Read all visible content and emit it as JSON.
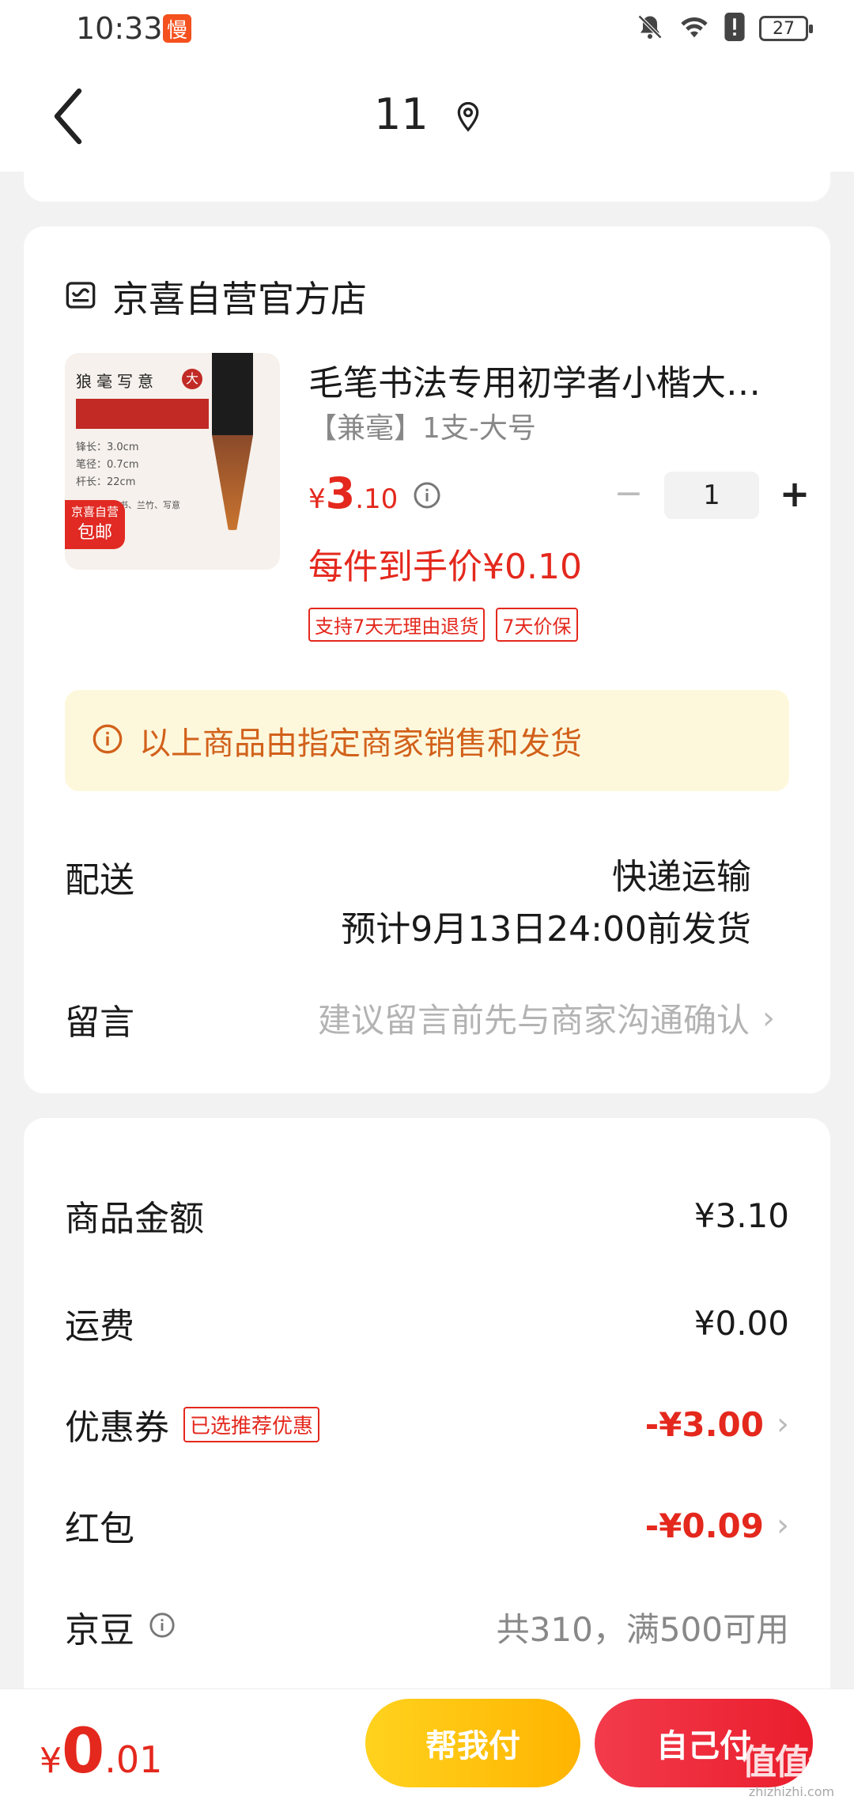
{
  "status_bar": {
    "time": "10:33",
    "slow_badge": "慢",
    "battery": "27"
  },
  "nav": {
    "title": "11"
  },
  "shop": {
    "name": "京喜自营官方店"
  },
  "thumbnail": {
    "title": "狼毫写意",
    "size_badge": "大",
    "spec_lines": [
      "锋长：3.0cm",
      "笔径：0.7cm",
      "杆长：22cm"
    ],
    "usage": "宜行楷、行书、兰竹、写意",
    "badge_line1": "京喜自营",
    "badge_line2": "包邮"
  },
  "product": {
    "title": "毛笔书法专用初学者小楷大楷狼毫写意",
    "spec": "【兼毫】1支-大号",
    "price_symbol": "¥",
    "price_int": "3",
    "price_dec": ".10",
    "quantity": "1",
    "minus": "−",
    "plus": "+",
    "unit_price": "每件到手价¥0.10",
    "tags": [
      "支持7天无理由退货",
      "7天价保"
    ]
  },
  "notice": {
    "text": "以上商品由指定商家销售和发货"
  },
  "delivery": {
    "label": "配送",
    "method": "快递运输",
    "eta": "预计9月13日24:00前发货"
  },
  "message": {
    "label": "留言",
    "placeholder": "建议留言前先与商家沟通确认"
  },
  "fees": {
    "goods": {
      "label": "商品金额",
      "value": "¥3.10"
    },
    "shipping": {
      "label": "运费",
      "value": "¥0.00"
    },
    "coupon": {
      "label": "优惠券",
      "tag": "已选推荐优惠",
      "value": "-¥3.00"
    },
    "redpacket": {
      "label": "红包",
      "value": "-¥0.09"
    },
    "jingdou": {
      "label": "京豆",
      "value": "共310，满500可用"
    }
  },
  "bottom": {
    "total_symbol": "¥",
    "total_int": "0",
    "total_dec": ".01",
    "help_pay": "帮我付",
    "self_pay": "自己付"
  },
  "watermark": {
    "logo": "值值值",
    "url": "zhizhizhi.com"
  },
  "colors": {
    "accent_red": "#e4281d",
    "notice_orange": "#d2611b",
    "help_yellow": "#ffc107",
    "self_red": "#ea1d2c"
  }
}
